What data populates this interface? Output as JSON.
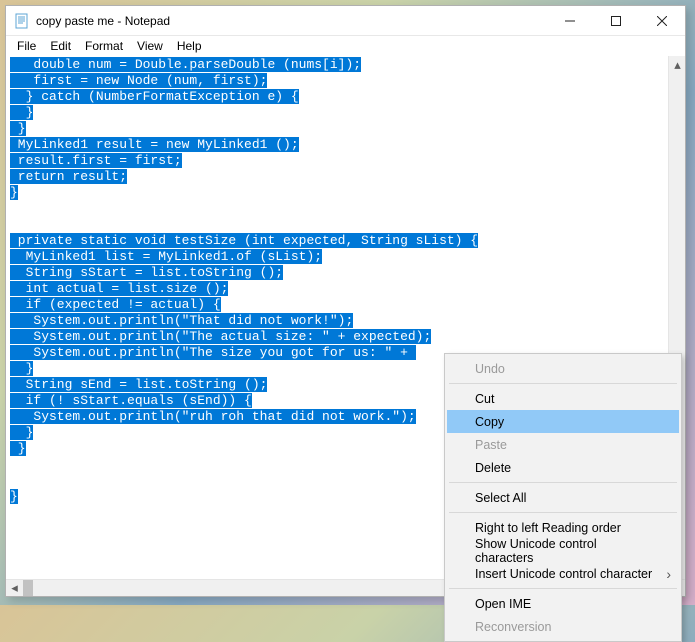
{
  "window": {
    "title": "copy paste me - Notepad"
  },
  "menu": {
    "file": "File",
    "edit": "Edit",
    "format": "Format",
    "view": "View",
    "help": "Help"
  },
  "code": {
    "l0": "   double num = Double.parseDouble (nums[i]);",
    "l1": "   first = new Node (num, first);",
    "l2": "  } catch (NumberFormatException e) {",
    "l3": "  }",
    "l4": " }",
    "l5": " MyLinked1 result = new MyLinked1 ();",
    "l6": " result.first = first;",
    "l7": " return result;",
    "l8": "}",
    "l9": "",
    "l10": "",
    "l11": " private static void testSize (int expected, String sList) {",
    "l12": "  MyLinked1 list = MyLinked1.of (sList);",
    "l13": "  String sStart = list.toString ();",
    "l14": "  int actual = list.size ();",
    "l15": "  if (expected != actual) {",
    "l16": "   System.out.println(\"That did not work!\");",
    "l17": "   System.out.println(\"The actual size: \" + expected);",
    "l18a": "   System.out.println(\"The size you got for us: \" + ",
    "l19": "  }",
    "l20": "  String sEnd = list.toString ();",
    "l21": "  if (! sStart.equals (sEnd)) {",
    "l22": "   System.out.println(\"ruh roh that did not work.\");",
    "l23": "  }",
    "l24": " }",
    "l25": "",
    "l26": "",
    "l27": "}"
  },
  "ctx": {
    "undo": "Undo",
    "cut": "Cut",
    "copy": "Copy",
    "paste": "Paste",
    "delete": "Delete",
    "selectall": "Select All",
    "rtl": "Right to left Reading order",
    "show": "Show Unicode control characters",
    "insert": "Insert Unicode control character",
    "open": "Open IME",
    "reconv": "Reconversion"
  }
}
